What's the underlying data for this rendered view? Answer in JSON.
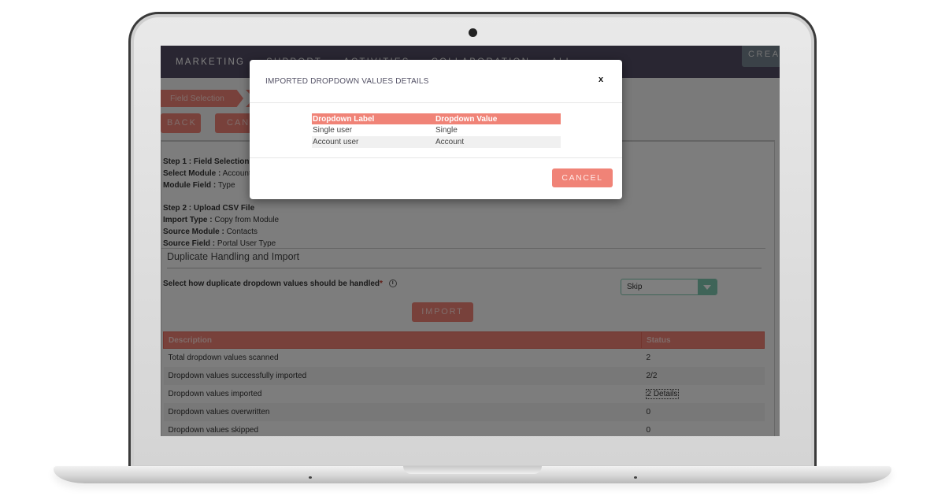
{
  "nav": {
    "items": [
      "MARKETING",
      "SUPPORT",
      "ACTIVITIES",
      "COLLABORATION",
      "ALL"
    ],
    "create_label": "CREAT"
  },
  "wizard": {
    "current_step": "Field Selection",
    "back_label": "BACK",
    "cancel_label": "CANC"
  },
  "summary": {
    "step1_title": "Step 1 : Field Selection",
    "select_module_label": "Select Module :",
    "select_module_value": "Accounts",
    "module_field_label": "Module Field :",
    "module_field_value": "Type",
    "step2_title": "Step 2 : Upload CSV File",
    "import_type_label": "Import Type :",
    "import_type_value": "Copy from Module",
    "source_module_label": "Source Module :",
    "source_module_value": "Contacts",
    "source_field_label": "Source Field :",
    "source_field_value": "Portal User Type"
  },
  "duplicate": {
    "section_title": "Duplicate Handling and Import",
    "question": "Select how duplicate dropdown values should be handled",
    "required_mark": "*",
    "info_glyph": "i",
    "selected_option": "Skip",
    "import_label": "IMPORT"
  },
  "results": {
    "headers": [
      "Description",
      "Status"
    ],
    "rows": [
      {
        "description": "Total dropdown values scanned",
        "status": "2"
      },
      {
        "description": "Dropdown values successfully imported",
        "status": "2/2"
      },
      {
        "description": "Dropdown values imported",
        "status": "2 Details"
      },
      {
        "description": "Dropdown values overwritten",
        "status": "0"
      },
      {
        "description": "Dropdown values skipped",
        "status": "0"
      }
    ]
  },
  "modal": {
    "title": "IMPORTED DROPDOWN VALUES DETAILS",
    "close_label": "x",
    "headers": [
      "Dropdown Label",
      "Dropdown Value"
    ],
    "rows": [
      {
        "label": "Single user",
        "value": "Single"
      },
      {
        "label": "Account user",
        "value": "Account"
      }
    ],
    "cancel_label": "CANCEL"
  },
  "colors": {
    "accent": "#f08377",
    "navbar": "#534d64",
    "select_accent": "#7fc8b0"
  }
}
